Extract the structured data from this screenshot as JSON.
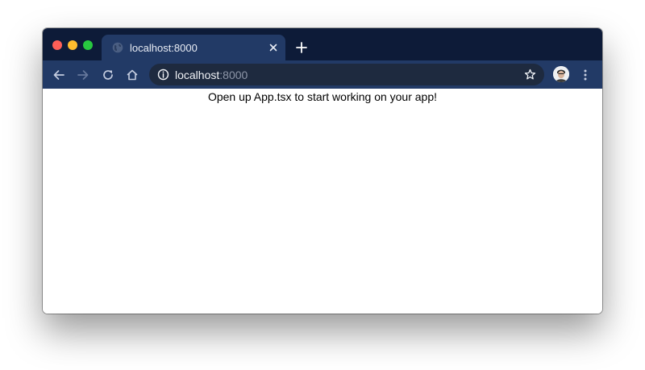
{
  "browser": {
    "tab": {
      "title": "localhost:8000",
      "favicon": "globe-icon"
    },
    "new_tab_icon": "plus-icon",
    "toolbar": {
      "back_icon": "arrow-left-icon",
      "forward_icon": "arrow-right-icon",
      "reload_icon": "reload-icon",
      "home_icon": "home-icon"
    },
    "address_bar": {
      "host": "localhost",
      "port": ":8000",
      "info_icon": "info-icon",
      "bookmark_icon": "star-icon"
    },
    "profile_icon": "avatar",
    "menu_icon": "kebab-menu-icon"
  },
  "page": {
    "message": "Open up App.tsx to start working on your app!"
  },
  "colors": {
    "titlebar": "#0d1b38",
    "tab_and_toolbar": "#223a66",
    "omnibox": "#1e2a3f",
    "close": "#fe5f57",
    "minimize": "#febc2e",
    "zoom": "#28c840"
  }
}
